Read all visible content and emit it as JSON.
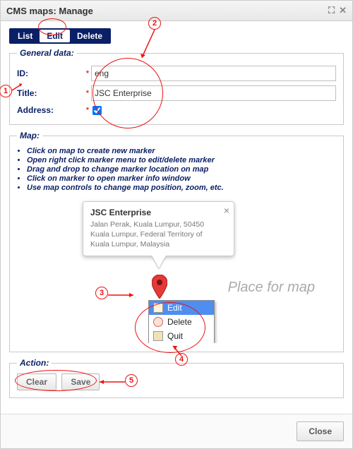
{
  "window": {
    "title": "CMS maps: Manage",
    "close_label": "Close"
  },
  "tabs": {
    "list": "List",
    "edit": "Edit",
    "delete": "Delete"
  },
  "general": {
    "legend": "General data:",
    "id_label": "ID:",
    "id_value": "eng",
    "title_label": "Title:",
    "title_value": "JSC Enterprise",
    "address_label": "Address:"
  },
  "map": {
    "legend": "Map:",
    "hints": [
      "Click on map to create new marker",
      "Open right click marker menu to edit/delete marker",
      "Drag and drop to change marker location on map",
      "Click on marker to open marker info window",
      "Use map controls to change map position, zoom, etc."
    ],
    "placeholder": "Place for map",
    "info": {
      "title": "JSC Enterprise",
      "address": "Jalan Perak, Kuala Lumpur, 50450 Kuala Lumpur, Federal Territory of Kuala Lumpur, Malaysia"
    },
    "context_menu": {
      "edit": "Edit",
      "delete": "Delete",
      "quit": "Quit"
    }
  },
  "action": {
    "legend": "Action:",
    "clear": "Clear",
    "save": "Save"
  },
  "annotations": {
    "n1": "1",
    "n2": "2",
    "n3": "3",
    "n4": "4",
    "n5": "5"
  }
}
